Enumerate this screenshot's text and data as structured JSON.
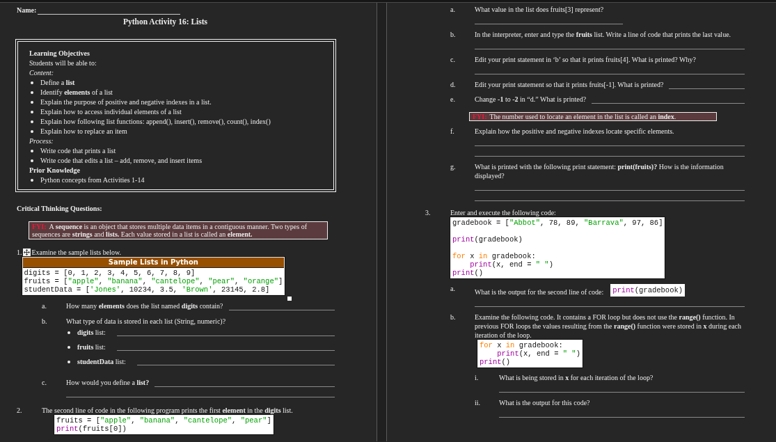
{
  "left_page": {
    "blocks": [
      {
        "kind": "name",
        "label": "Name:"
      },
      {
        "kind": "title",
        "text": "Python Activity 16: Lists"
      },
      {
        "kind": "objectives",
        "lines": [
          {
            "kind": "heading",
            "text": "Learning Objectives"
          },
          {
            "kind": "text",
            "text": "Students will be able to:"
          },
          {
            "kind": "italic",
            "text": "Content:"
          },
          {
            "kind": "bullet",
            "text": "Define a **list**"
          },
          {
            "kind": "bullet",
            "text": "Identify **elements** of a list"
          },
          {
            "kind": "bullet",
            "text": "Explain the purpose of positive and negative indexes in a list."
          },
          {
            "kind": "bullet",
            "text": "Explain how to access individual elements of a list"
          },
          {
            "kind": "bullet",
            "text": "Explain how following list functions: append(), insert(), remove(), count(), index()"
          },
          {
            "kind": "bullet",
            "text": "Explain how to replace an item"
          },
          {
            "kind": "italic",
            "text": "Process:"
          },
          {
            "kind": "bullet",
            "text": "Write code that prints a list"
          },
          {
            "kind": "bullet",
            "text": "Write code that edits a list – add, remove, and insert items"
          },
          {
            "kind": "heading",
            "text": "Prior Knowledge"
          },
          {
            "kind": "bullet",
            "text": "Python concepts from Activities 1-14"
          }
        ]
      },
      {
        "kind": "heading",
        "text": "Critical Thinking Questions:"
      },
      {
        "kind": "fyi",
        "label": "FYI:",
        "text": "A **sequence** is an object that stores multiple data items in a contiguous manner. Two types of sequences are **strings** and **lists.** Each value stored in a list is called an **element.**"
      },
      {
        "kind": "question",
        "number": "1.",
        "handle": true,
        "text": "Examine the sample lists below.",
        "code": {
          "title": "Sample Lists in Python",
          "lines": [
            {
              "tokens": [
                {
                  "kind": "plain",
                  "text": "digits = [0, 1, 2, 3, 4, 5, 6, 7, 8, 9]"
                }
              ]
            },
            {
              "tokens": [
                {
                  "kind": "plain",
                  "text": "fruits = ["
                },
                {
                  "kind": "string",
                  "text": "\"apple\""
                },
                {
                  "kind": "plain",
                  "text": ", "
                },
                {
                  "kind": "string",
                  "text": "\"banana\""
                },
                {
                  "kind": "plain",
                  "text": ", "
                },
                {
                  "kind": "string",
                  "text": "\"cantelope\""
                },
                {
                  "kind": "plain",
                  "text": ", "
                },
                {
                  "kind": "string",
                  "text": "\"pear\""
                },
                {
                  "kind": "plain",
                  "text": ", "
                },
                {
                  "kind": "string",
                  "text": "\"orange\""
                },
                {
                  "kind": "plain",
                  "text": "]"
                }
              ]
            },
            {
              "tokens": [
                {
                  "kind": "plain",
                  "text": "studentData = ["
                },
                {
                  "kind": "string",
                  "text": "'Jones'"
                },
                {
                  "kind": "plain",
                  "text": ", 10234, 3.5, "
                },
                {
                  "kind": "string",
                  "text": "'Brown'"
                },
                {
                  "kind": "plain",
                  "text": ", 23145, 2.8]"
                }
              ]
            }
          ]
        }
      },
      {
        "kind": "sub",
        "letter": "a.",
        "text": "How many **elements** does the list named **digits** contain?",
        "blank_inline": true
      },
      {
        "kind": "sub",
        "letter": "b.",
        "text": "What type of data is stored in each list (String, numeric)?",
        "bullets": [
          {
            "text": "**digits** list:"
          },
          {
            "text": "**fruits** list:"
          },
          {
            "text": "**studentData** list:"
          }
        ]
      },
      {
        "kind": "sub",
        "letter": "c.",
        "text": "How would you define a **list?**",
        "blank_inline": true,
        "answer_lines": [
          {
            "kind": "full"
          }
        ]
      },
      {
        "kind": "question",
        "number": "2.",
        "text": "The second line of code in the following program prints the first **element** in the **digits** list.",
        "code": {
          "lines": [
            {
              "tokens": [
                {
                  "kind": "plain",
                  "text": "fruits = ["
                },
                {
                  "kind": "string",
                  "text": "\"apple\""
                },
                {
                  "kind": "plain",
                  "text": ", "
                },
                {
                  "kind": "string",
                  "text": "\"banana\""
                },
                {
                  "kind": "plain",
                  "text": ", "
                },
                {
                  "kind": "string",
                  "text": "\"cantelope\""
                },
                {
                  "kind": "plain",
                  "text": ", "
                },
                {
                  "kind": "string",
                  "text": "\"pear\""
                },
                {
                  "kind": "plain",
                  "text": "]"
                }
              ]
            },
            {
              "tokens": [
                {
                  "kind": "builtin",
                  "text": "print"
                },
                {
                  "kind": "plain",
                  "text": "(fruits[0])"
                }
              ]
            }
          ]
        }
      }
    ]
  },
  "right_page": {
    "blocks": [
      {
        "kind": "sub",
        "letter": "a.",
        "text": "What value in the list does fruits[3] represent?",
        "answer_lines": [
          {
            "kind": "short"
          }
        ]
      },
      {
        "kind": "sub",
        "letter": "b.",
        "text": "In the interpreter, enter and type the **fruits** list. Write a line of code that prints the last value.",
        "answer_lines": [
          {
            "kind": "full"
          }
        ]
      },
      {
        "kind": "sub",
        "letter": "c.",
        "text": "Edit your print statement in ‘b’ so that it prints fruits[4]. What is printed? Why?",
        "answer_lines": [
          {
            "kind": "full"
          }
        ]
      },
      {
        "kind": "sub",
        "letter": "d.",
        "text": "Edit your print statement so that it prints fruits[-1]. What is printed?",
        "blank_inline": true
      },
      {
        "kind": "sub",
        "letter": "e.",
        "text": "Change **-1** to **-2** in “d.” What is printed?",
        "blank_inline": true
      },
      {
        "kind": "fyi",
        "label": "FYI:",
        "text": "The number used to locate an element in the list is called an **index**."
      },
      {
        "kind": "sub",
        "letter": "f.",
        "text": "Explain how the positive and negative indexes locate specific elements.",
        "answer_lines": [
          {
            "kind": "full"
          },
          {
            "kind": "full"
          }
        ]
      },
      {
        "kind": "sub",
        "letter": "g.",
        "text": "What is printed with the following print statement: **print(fruits)?** How is the information displayed?",
        "answer_lines": [
          {
            "kind": "full"
          },
          {
            "kind": "full"
          }
        ]
      },
      {
        "kind": "question",
        "number": "3.",
        "text": "Enter and execute the following code:",
        "code": {
          "lines": [
            {
              "tokens": [
                {
                  "kind": "plain",
                  "text": "gradebook = ["
                },
                {
                  "kind": "string",
                  "text": "\"Abbot\""
                },
                {
                  "kind": "plain",
                  "text": ", 78, 89, "
                },
                {
                  "kind": "string",
                  "text": "\"Barrava\""
                },
                {
                  "kind": "plain",
                  "text": ", 97, 86]"
                }
              ]
            },
            {
              "space_before": true,
              "tokens": [
                {
                  "kind": "builtin",
                  "text": "print"
                },
                {
                  "kind": "plain",
                  "text": "(gradebook)"
                }
              ]
            },
            {
              "space_before": true,
              "tokens": [
                {
                  "kind": "keyword",
                  "text": "for"
                },
                {
                  "kind": "plain",
                  "text": " x "
                },
                {
                  "kind": "keyword",
                  "text": "in"
                },
                {
                  "kind": "plain",
                  "text": " gradebook:"
                }
              ]
            },
            {
              "indented": true,
              "tokens": [
                {
                  "kind": "builtin",
                  "text": "print"
                },
                {
                  "kind": "plain",
                  "text": "(x, end = "
                },
                {
                  "kind": "string",
                  "text": "\" \""
                },
                {
                  "kind": "plain",
                  "text": ")"
                }
              ]
            },
            {
              "tokens": [
                {
                  "kind": "builtin",
                  "text": "print"
                },
                {
                  "kind": "plain",
                  "text": "()"
                }
              ]
            }
          ]
        }
      },
      {
        "kind": "sub",
        "letter": "a.",
        "text": "What is the output for the second line of code:",
        "inline_code": [
          {
            "kind": "builtin",
            "text": "print"
          },
          {
            "kind": "plain",
            "text": "(gradebook)"
          }
        ],
        "answer_lines": [
          {
            "kind": "full"
          }
        ]
      },
      {
        "kind": "sub",
        "letter": "b.",
        "text": "Examine the following code. It contains a FOR loop but does not use the **range()** function. In previous FOR loops the values resulting from the **range()** function were stored in **x** during each iteration of the loop.",
        "code": {
          "lines": [
            {
              "tokens": [
                {
                  "kind": "keyword",
                  "text": "for"
                },
                {
                  "kind": "plain",
                  "text": " x "
                },
                {
                  "kind": "keyword",
                  "text": "in"
                },
                {
                  "kind": "plain",
                  "text": " gradebook:"
                }
              ]
            },
            {
              "indented": true,
              "tokens": [
                {
                  "kind": "builtin",
                  "text": "print"
                },
                {
                  "kind": "plain",
                  "text": "(x, end = "
                },
                {
                  "kind": "string",
                  "text": "\" \""
                },
                {
                  "kind": "plain",
                  "text": ")"
                }
              ]
            },
            {
              "tokens": [
                {
                  "kind": "builtin",
                  "text": "print"
                },
                {
                  "kind": "plain",
                  "text": "()"
                }
              ]
            }
          ]
        }
      },
      {
        "kind": "subsub",
        "letter": "i.",
        "text": "What is being stored in **x** for each iteration of the loop?",
        "answer_lines": [
          {
            "kind": "full"
          }
        ]
      },
      {
        "kind": "subsub",
        "letter": "ii.",
        "text": "What is the output for this code?",
        "answer_lines": [
          {
            "kind": "full"
          }
        ]
      }
    ]
  }
}
